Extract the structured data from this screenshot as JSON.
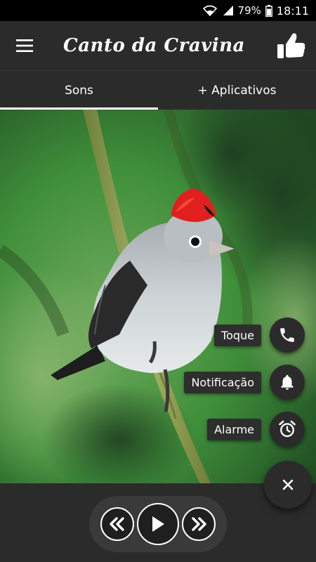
{
  "status_bar": {
    "battery": "79%",
    "time": "18:11",
    "icons": [
      "wifi-icon",
      "signal-icon",
      "battery-icon"
    ]
  },
  "app_bar": {
    "title": "Canto da Cravina",
    "menu_icon": "hamburger-menu-icon",
    "like_icon": "thumbs-up-icon"
  },
  "tabs": [
    {
      "label": "Sons",
      "active": true
    },
    {
      "label": "+ Aplicativos",
      "active": false
    }
  ],
  "fab_menu": {
    "items": [
      {
        "label": "Toque",
        "icon": "phone-icon"
      },
      {
        "label": "Notificação",
        "icon": "bell-icon"
      },
      {
        "label": "Alarme",
        "icon": "alarm-clock-icon"
      }
    ],
    "close_icon": "close-icon"
  },
  "player": {
    "controls": [
      "rewind-icon",
      "play-icon",
      "fast-forward-icon"
    ]
  },
  "colors": {
    "bar": "#2b2b2b",
    "crest": "#e0201e",
    "foliage": "#3f8f3a"
  }
}
